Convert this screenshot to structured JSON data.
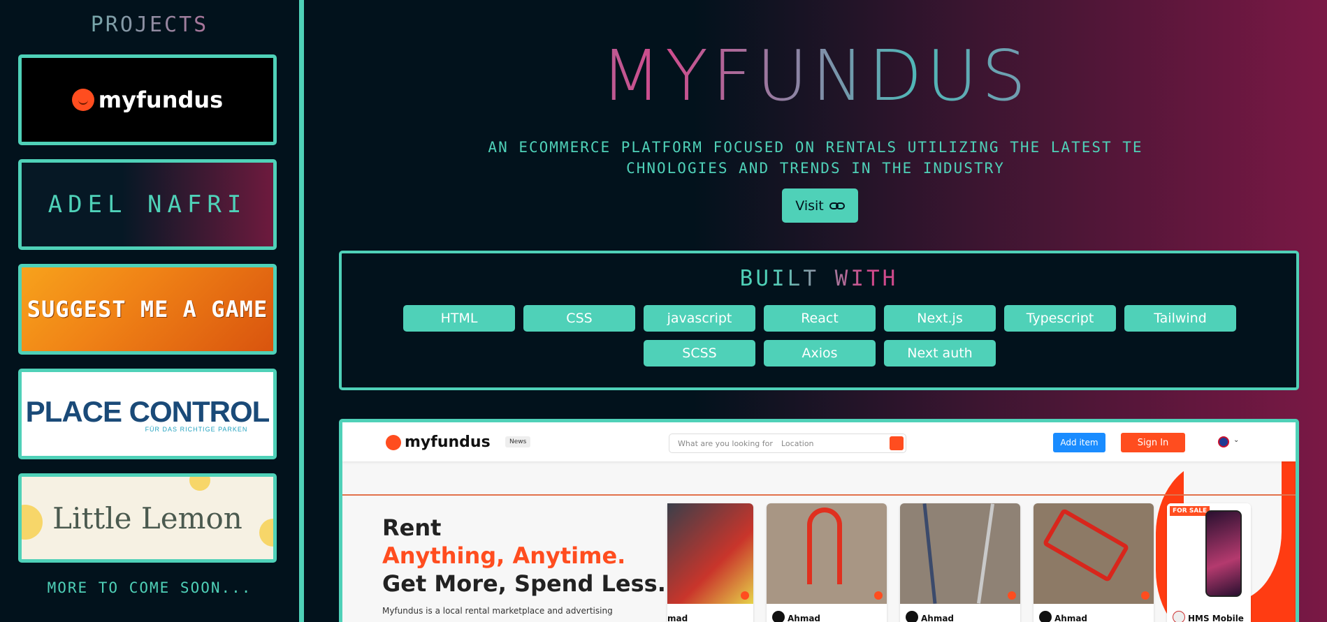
{
  "sidebar": {
    "title": "PROJECTS",
    "cards": [
      {
        "label": "myfundus"
      },
      {
        "label": "ADEL NAFRI"
      },
      {
        "label": "SUGGEST ME A GAME"
      },
      {
        "label": "PLACE CONTROL",
        "sub": "FÜR DAS RICHTIGE PARKEN"
      },
      {
        "label": "Little Lemon"
      }
    ],
    "more": "MORE TO COME SOON..."
  },
  "main": {
    "title": "MYFUNDUS",
    "subtitle_line1": "AN ECOMMERCE PLATFORM FOCUSED ON RENTALS UTILIZING THE LATEST TE",
    "subtitle_line2": "CHNOLOGIES AND TRENDS IN THE INDUSTRY",
    "visit_label": "Visit",
    "built_title": "BUILT WITH",
    "tech": [
      "HTML",
      "CSS",
      "javascript",
      "React",
      "Next.js",
      "Typescript",
      "Tailwind",
      "SCSS",
      "Axios",
      "Next auth"
    ]
  },
  "screenshot": {
    "logo": "myfundus",
    "news": "News",
    "search_placeholder": "What are you looking for",
    "location_placeholder": "Location",
    "add_item": "Add item",
    "sign_in": "Sign In",
    "hero_line1": "Rent",
    "hero_line2": "Anything, Anytime.",
    "hero_line3": "Get More, Spend Less.",
    "hero_text": "Myfundus is a local rental marketplace and advertising",
    "products": [
      {
        "owner": "mad"
      },
      {
        "owner": "Ahmad"
      },
      {
        "owner": "Ahmad"
      },
      {
        "owner": "Ahmad"
      },
      {
        "owner": "HMS Mobile",
        "badge": "FOR SALE"
      }
    ]
  },
  "colors": {
    "accent": "#4fd1b8",
    "pink": "#d04a8c",
    "bg": "#02121c",
    "orange": "#ff4d1f"
  }
}
